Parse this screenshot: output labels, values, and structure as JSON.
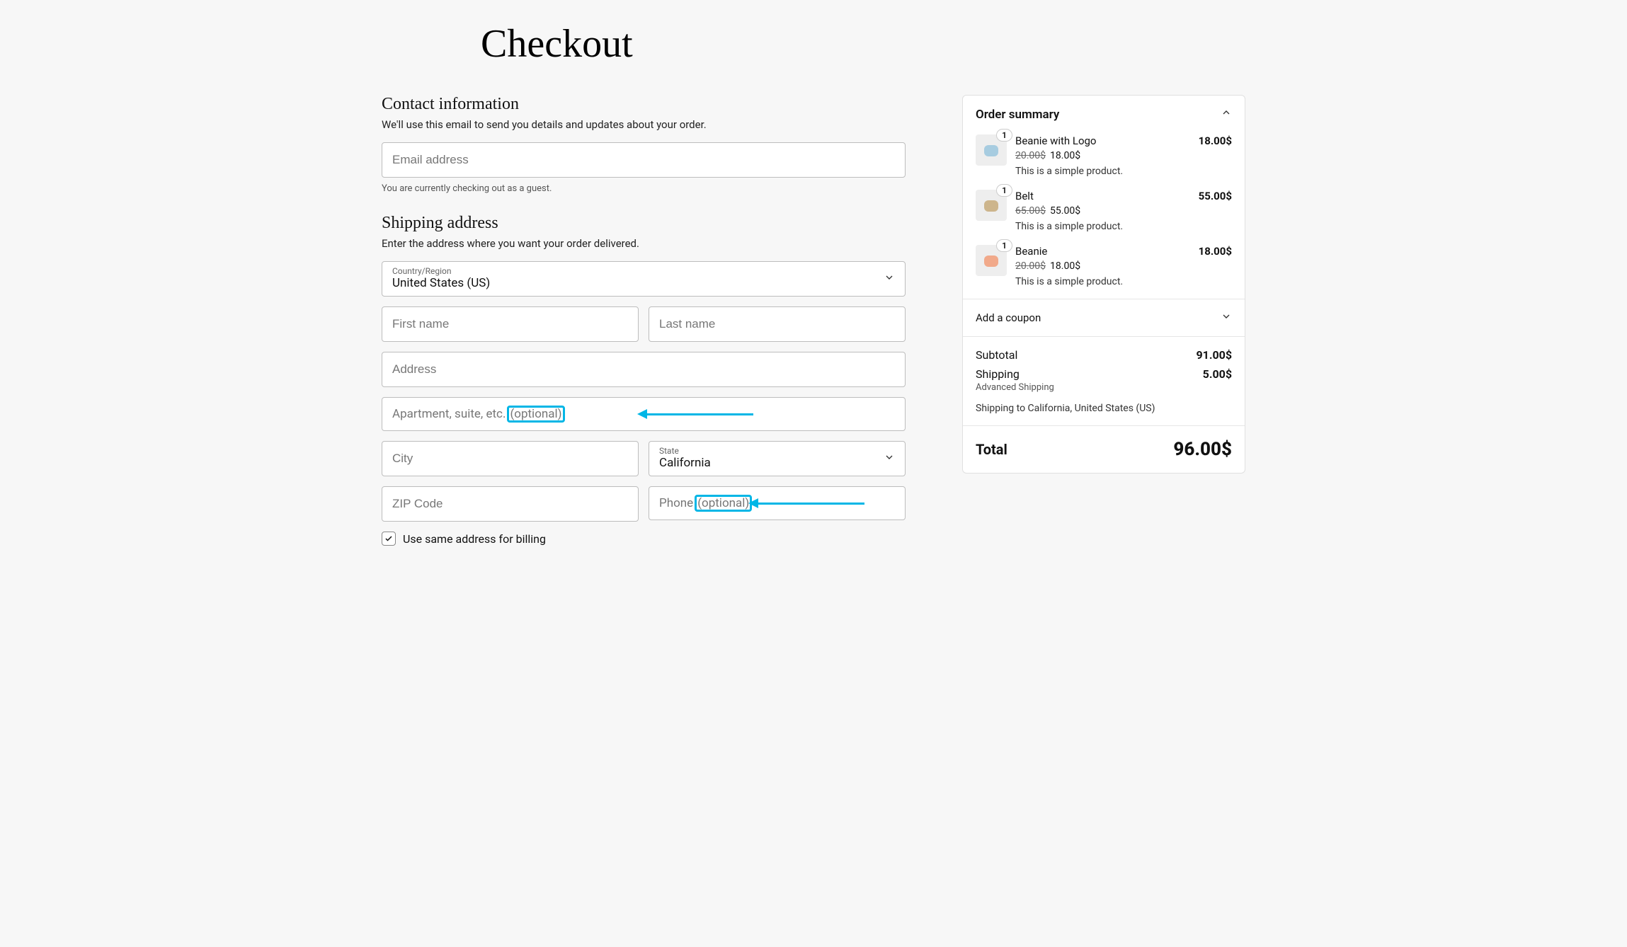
{
  "page": {
    "title": "Checkout"
  },
  "contact": {
    "heading": "Contact information",
    "sub": "We'll use this email to send you details and updates about your order.",
    "email_placeholder": "Email address",
    "guest_note": "You are currently checking out as a guest."
  },
  "shipping": {
    "heading": "Shipping address",
    "sub": "Enter the address where you want your order delivered.",
    "country_label": "Country/Region",
    "country_value": "United States (US)",
    "first_name_placeholder": "First name",
    "last_name_placeholder": "Last name",
    "address_placeholder": "Address",
    "apt_placeholder_main": "Apartment, suite, etc.",
    "apt_placeholder_opt": "(optional)",
    "city_placeholder": "City",
    "state_label": "State",
    "state_value": "California",
    "zip_placeholder": "ZIP Code",
    "phone_placeholder_main": "Phone",
    "phone_placeholder_opt": "(optional)",
    "same_billing_label": "Use same address for billing"
  },
  "order_summary": {
    "heading": "Order summary",
    "items": [
      {
        "qty": "1",
        "name": "Beanie with Logo",
        "line_total": "18.00$",
        "orig": "20.00$",
        "sale": "18.00$",
        "desc": "This is a simple product.",
        "thumb_color": "#a7cce0"
      },
      {
        "qty": "1",
        "name": "Belt",
        "line_total": "55.00$",
        "orig": "65.00$",
        "sale": "55.00$",
        "desc": "This is a simple product.",
        "thumb_color": "#cdb58c"
      },
      {
        "qty": "1",
        "name": "Beanie",
        "line_total": "18.00$",
        "orig": "20.00$",
        "sale": "18.00$",
        "desc": "This is a simple product.",
        "thumb_color": "#f1a98a"
      }
    ],
    "coupon_label": "Add a coupon",
    "subtotal_label": "Subtotal",
    "subtotal_value": "91.00$",
    "shipping_label": "Shipping",
    "shipping_value": "5.00$",
    "shipping_method": "Advanced Shipping",
    "shipping_to": "Shipping to California, United States (US)",
    "total_label": "Total",
    "total_value": "96.00$"
  }
}
